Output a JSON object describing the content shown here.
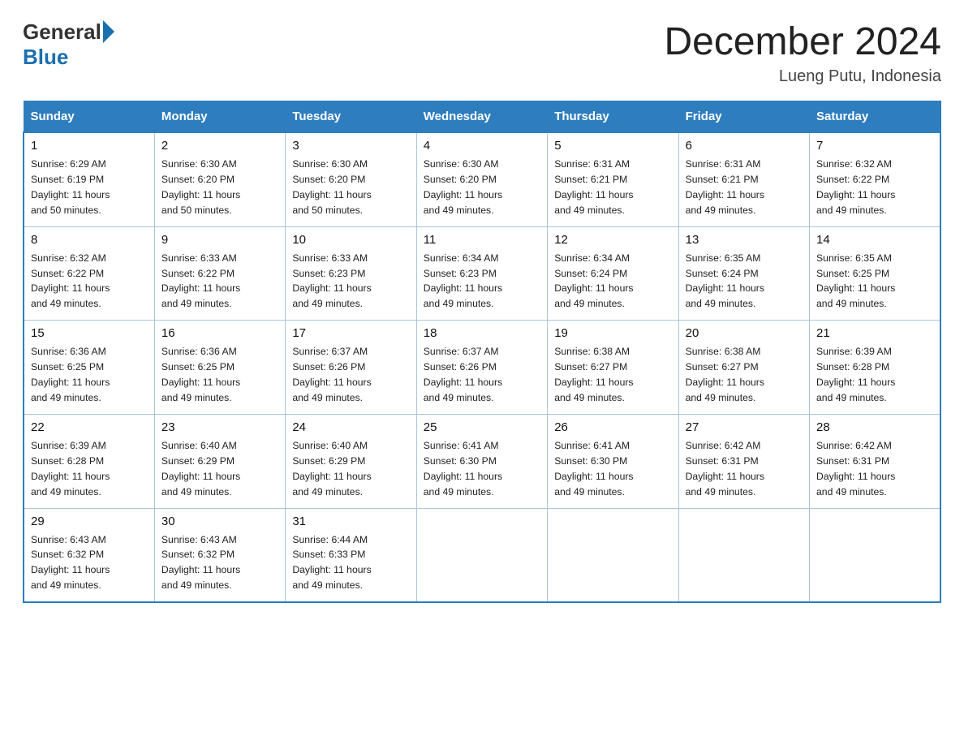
{
  "header": {
    "logo_general": "General",
    "logo_blue": "Blue",
    "month_title": "December 2024",
    "location": "Lueng Putu, Indonesia"
  },
  "days_of_week": [
    "Sunday",
    "Monday",
    "Tuesday",
    "Wednesday",
    "Thursday",
    "Friday",
    "Saturday"
  ],
  "weeks": [
    [
      {
        "day": "1",
        "sunrise": "6:29 AM",
        "sunset": "6:19 PM",
        "daylight": "11 hours and 50 minutes."
      },
      {
        "day": "2",
        "sunrise": "6:30 AM",
        "sunset": "6:20 PM",
        "daylight": "11 hours and 50 minutes."
      },
      {
        "day": "3",
        "sunrise": "6:30 AM",
        "sunset": "6:20 PM",
        "daylight": "11 hours and 50 minutes."
      },
      {
        "day": "4",
        "sunrise": "6:30 AM",
        "sunset": "6:20 PM",
        "daylight": "11 hours and 49 minutes."
      },
      {
        "day": "5",
        "sunrise": "6:31 AM",
        "sunset": "6:21 PM",
        "daylight": "11 hours and 49 minutes."
      },
      {
        "day": "6",
        "sunrise": "6:31 AM",
        "sunset": "6:21 PM",
        "daylight": "11 hours and 49 minutes."
      },
      {
        "day": "7",
        "sunrise": "6:32 AM",
        "sunset": "6:22 PM",
        "daylight": "11 hours and 49 minutes."
      }
    ],
    [
      {
        "day": "8",
        "sunrise": "6:32 AM",
        "sunset": "6:22 PM",
        "daylight": "11 hours and 49 minutes."
      },
      {
        "day": "9",
        "sunrise": "6:33 AM",
        "sunset": "6:22 PM",
        "daylight": "11 hours and 49 minutes."
      },
      {
        "day": "10",
        "sunrise": "6:33 AM",
        "sunset": "6:23 PM",
        "daylight": "11 hours and 49 minutes."
      },
      {
        "day": "11",
        "sunrise": "6:34 AM",
        "sunset": "6:23 PM",
        "daylight": "11 hours and 49 minutes."
      },
      {
        "day": "12",
        "sunrise": "6:34 AM",
        "sunset": "6:24 PM",
        "daylight": "11 hours and 49 minutes."
      },
      {
        "day": "13",
        "sunrise": "6:35 AM",
        "sunset": "6:24 PM",
        "daylight": "11 hours and 49 minutes."
      },
      {
        "day": "14",
        "sunrise": "6:35 AM",
        "sunset": "6:25 PM",
        "daylight": "11 hours and 49 minutes."
      }
    ],
    [
      {
        "day": "15",
        "sunrise": "6:36 AM",
        "sunset": "6:25 PM",
        "daylight": "11 hours and 49 minutes."
      },
      {
        "day": "16",
        "sunrise": "6:36 AM",
        "sunset": "6:25 PM",
        "daylight": "11 hours and 49 minutes."
      },
      {
        "day": "17",
        "sunrise": "6:37 AM",
        "sunset": "6:26 PM",
        "daylight": "11 hours and 49 minutes."
      },
      {
        "day": "18",
        "sunrise": "6:37 AM",
        "sunset": "6:26 PM",
        "daylight": "11 hours and 49 minutes."
      },
      {
        "day": "19",
        "sunrise": "6:38 AM",
        "sunset": "6:27 PM",
        "daylight": "11 hours and 49 minutes."
      },
      {
        "day": "20",
        "sunrise": "6:38 AM",
        "sunset": "6:27 PM",
        "daylight": "11 hours and 49 minutes."
      },
      {
        "day": "21",
        "sunrise": "6:39 AM",
        "sunset": "6:28 PM",
        "daylight": "11 hours and 49 minutes."
      }
    ],
    [
      {
        "day": "22",
        "sunrise": "6:39 AM",
        "sunset": "6:28 PM",
        "daylight": "11 hours and 49 minutes."
      },
      {
        "day": "23",
        "sunrise": "6:40 AM",
        "sunset": "6:29 PM",
        "daylight": "11 hours and 49 minutes."
      },
      {
        "day": "24",
        "sunrise": "6:40 AM",
        "sunset": "6:29 PM",
        "daylight": "11 hours and 49 minutes."
      },
      {
        "day": "25",
        "sunrise": "6:41 AM",
        "sunset": "6:30 PM",
        "daylight": "11 hours and 49 minutes."
      },
      {
        "day": "26",
        "sunrise": "6:41 AM",
        "sunset": "6:30 PM",
        "daylight": "11 hours and 49 minutes."
      },
      {
        "day": "27",
        "sunrise": "6:42 AM",
        "sunset": "6:31 PM",
        "daylight": "11 hours and 49 minutes."
      },
      {
        "day": "28",
        "sunrise": "6:42 AM",
        "sunset": "6:31 PM",
        "daylight": "11 hours and 49 minutes."
      }
    ],
    [
      {
        "day": "29",
        "sunrise": "6:43 AM",
        "sunset": "6:32 PM",
        "daylight": "11 hours and 49 minutes."
      },
      {
        "day": "30",
        "sunrise": "6:43 AM",
        "sunset": "6:32 PM",
        "daylight": "11 hours and 49 minutes."
      },
      {
        "day": "31",
        "sunrise": "6:44 AM",
        "sunset": "6:33 PM",
        "daylight": "11 hours and 49 minutes."
      },
      null,
      null,
      null,
      null
    ]
  ],
  "labels": {
    "sunrise": "Sunrise:",
    "sunset": "Sunset:",
    "daylight": "Daylight:"
  }
}
